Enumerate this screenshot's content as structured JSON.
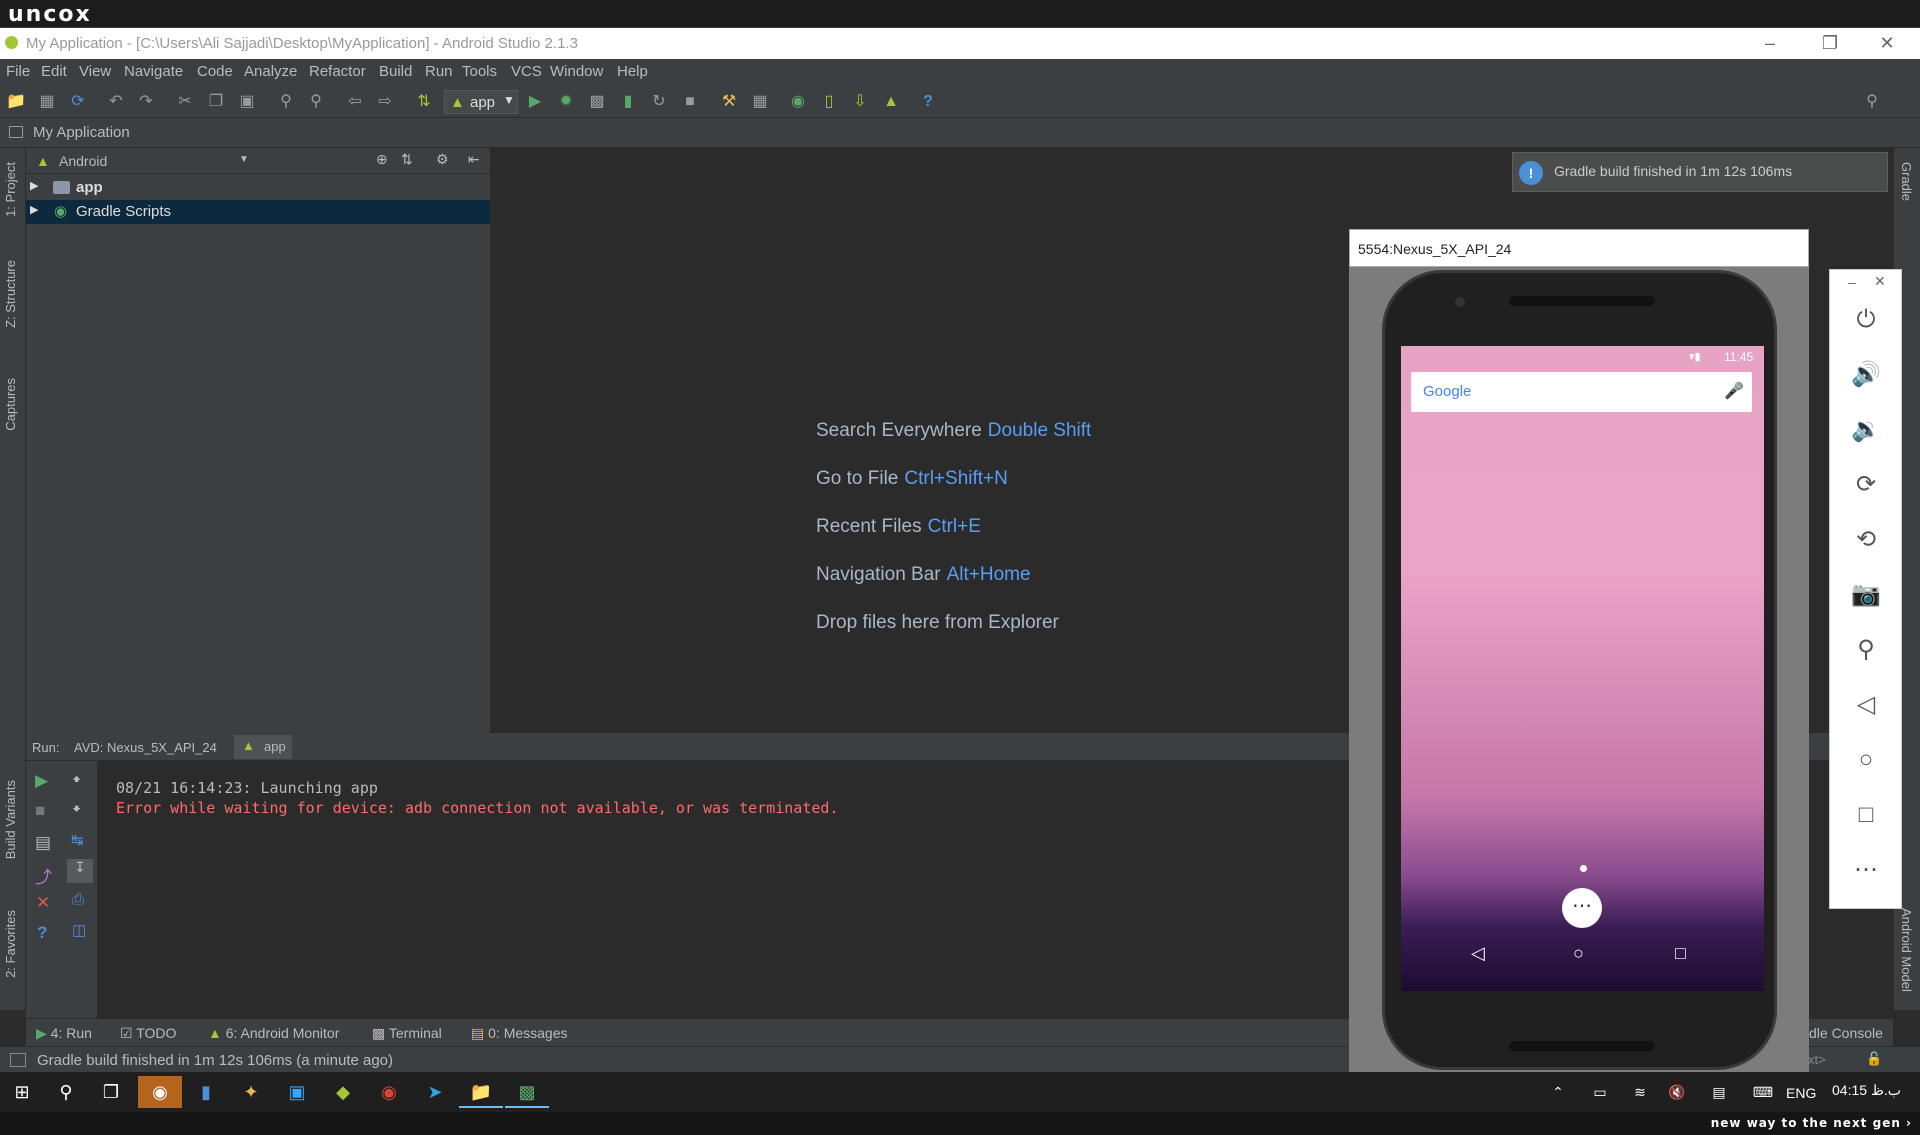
{
  "brand": {
    "top": "uncox",
    "bottom": "new way to the next gen ›"
  },
  "window": {
    "title": "My Application - [C:\\Users\\Ali Sajjadi\\Desktop\\MyApplication] - Android Studio 2.1.3"
  },
  "menu": [
    "File",
    "Edit",
    "View",
    "Navigate",
    "Code",
    "Analyze",
    "Refactor",
    "Build",
    "Run",
    "Tools",
    "VCS",
    "Window",
    "Help"
  ],
  "toolbar": {
    "run_config": "app"
  },
  "breadcrumb": "My Application",
  "left_tabs": {
    "project": "1: Project",
    "structure": "Z: Structure",
    "captures": "Captures",
    "build_variants": "Build Variants",
    "favorites": "2: Favorites"
  },
  "right_tabs": {
    "gradle": "Gradle",
    "android_model": "Android Model"
  },
  "project": {
    "view": "Android",
    "items": [
      {
        "label": "app"
      },
      {
        "label": "Gradle Scripts"
      }
    ]
  },
  "editor_hints": [
    {
      "label": "Search Everywhere",
      "key": "Double Shift"
    },
    {
      "label": "Go to File",
      "key": "Ctrl+Shift+N"
    },
    {
      "label": "Recent Files",
      "key": "Ctrl+E"
    },
    {
      "label": "Navigation Bar",
      "key": "Alt+Home"
    },
    {
      "label": "Drop files here from Explorer",
      "key": ""
    }
  ],
  "notification": {
    "text": "Gradle build finished in 1m 12s 106ms"
  },
  "run": {
    "label": "Run:",
    "tabs": [
      "AVD: Nexus_5X_API_24",
      "app"
    ],
    "lines": [
      {
        "text": "08/21 16:14:23: Launching app",
        "color": "#bbbbbb"
      },
      {
        "text": "Error while waiting for device: adb connection not available, or was terminated.",
        "color": "#ff6b68"
      }
    ]
  },
  "bottom_tabs": [
    "4: Run",
    "TODO",
    "6: Android Monitor",
    "Terminal",
    "0: Messages"
  ],
  "bottom_right_tab": "dle Console",
  "bottom_right_frag": "xt>",
  "status": "Gradle build finished in 1m 12s 106ms (a minute ago)",
  "emulator": {
    "title": "5554:Nexus_5X_API_24",
    "time": "11:45",
    "search_logo": "Google"
  },
  "taskbar": {
    "lang": "ENG",
    "clock": "04:15 ب.ظ"
  },
  "colors": {
    "accent": "#589df6",
    "error": "#ff6b68",
    "run_green": "#59a869",
    "android_green": "#a4c639"
  }
}
